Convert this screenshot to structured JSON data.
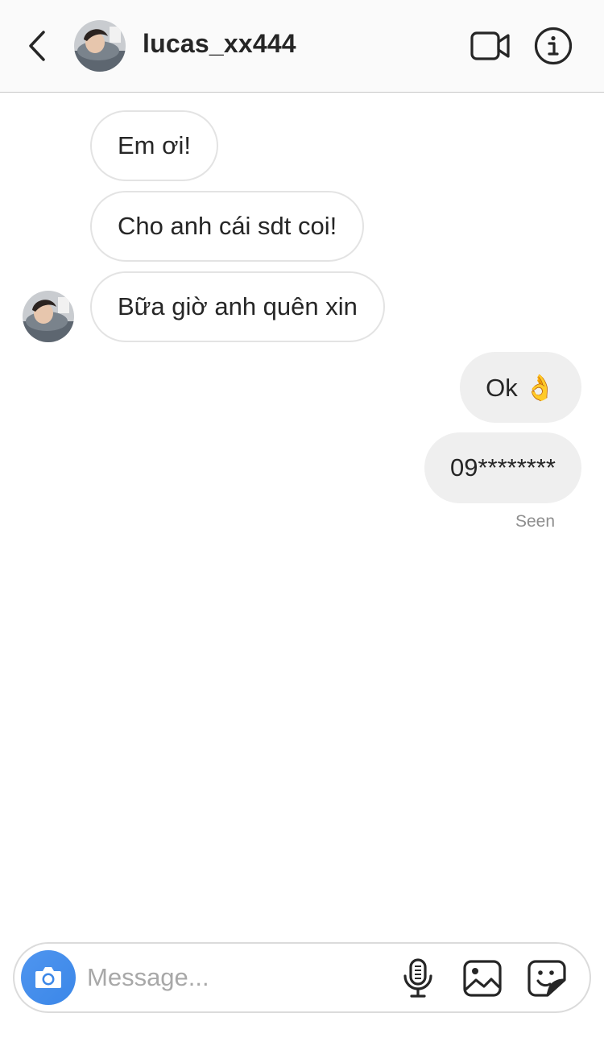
{
  "header": {
    "username": "lucas_xx444",
    "icons": {
      "back": "chevron-left-icon",
      "video": "video-camera-icon",
      "info": "info-icon"
    }
  },
  "messages": [
    {
      "direction": "incoming",
      "text": "Em ơi!"
    },
    {
      "direction": "incoming",
      "text": "Cho anh cái sdt coi!"
    },
    {
      "direction": "incoming",
      "text": "Bữa giờ anh quên xin"
    },
    {
      "direction": "outgoing",
      "text": "Ok 👌"
    },
    {
      "direction": "outgoing",
      "text": "09********"
    }
  ],
  "status": {
    "seen_label": "Seen"
  },
  "composer": {
    "placeholder": "Message...",
    "value": "",
    "icons": {
      "camera": "camera-icon",
      "mic": "microphone-icon",
      "gallery": "image-icon",
      "sticker": "sticker-icon"
    }
  },
  "colors": {
    "header_bg": "#fafafa",
    "incoming_border": "#e3e3e3",
    "outgoing_bg": "#efefef",
    "camera_button": "#3b87e8",
    "seen_text": "#8e8e8e"
  }
}
